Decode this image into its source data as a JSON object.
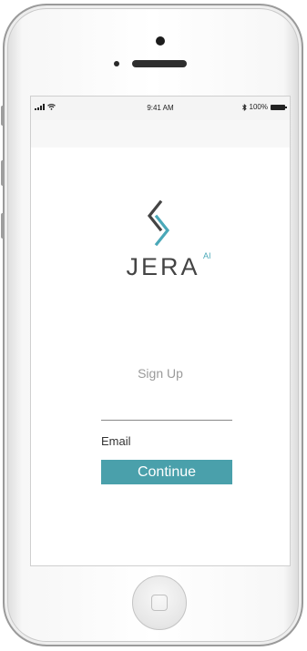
{
  "status_bar": {
    "time": "9:41 AM",
    "battery_percent": "100%",
    "icons": [
      "signal-icon",
      "wifi-icon",
      "bluetooth-icon",
      "battery-icon"
    ]
  },
  "app": {
    "logo_text": "JERA",
    "logo_superscript": "AI",
    "signup_heading": "Sign Up",
    "email_label": "Email",
    "continue_label": "Continue"
  },
  "colors": {
    "accent": "#4aa0ab",
    "logo_accent": "#4aa8b8",
    "logo_dark": "#444444",
    "heading_gray": "#9a9a9a"
  }
}
